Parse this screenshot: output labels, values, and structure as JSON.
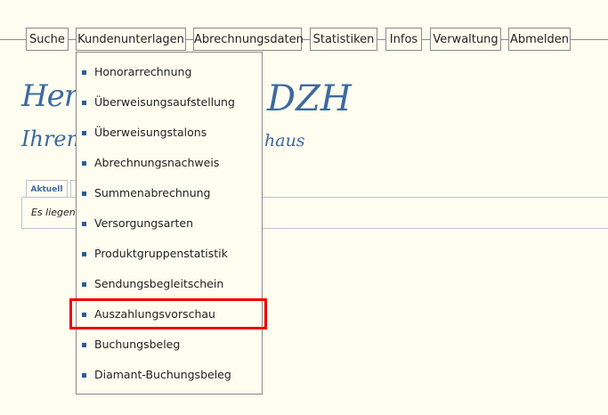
{
  "nav": {
    "items": [
      {
        "label": "Suche"
      },
      {
        "label": "Kundenunterlagen"
      },
      {
        "label": "Abrechnungsdaten"
      },
      {
        "label": "Statistiken"
      },
      {
        "label": "Infos"
      },
      {
        "label": "Verwaltung"
      },
      {
        "label": "Abmelden"
      }
    ]
  },
  "greeting": {
    "line1": "Herzli",
    "line1_end": "DZH",
    "line2": "Ihrem p",
    "line2_end": "haus"
  },
  "tabs": {
    "active_label": "Aktuell"
  },
  "panel": {
    "text": "Es liegen"
  },
  "dropdown": {
    "items": [
      {
        "label": "Honorarrechnung"
      },
      {
        "label": "Überweisungsaufstellung"
      },
      {
        "label": "Überweisungstalons"
      },
      {
        "label": "Abrechnungsnachweis"
      },
      {
        "label": "Summenabrechnung"
      },
      {
        "label": "Versorgungsarten"
      },
      {
        "label": "Produktgruppenstatistik"
      },
      {
        "label": "Sendungsbegleitschein"
      },
      {
        "label": "Auszahlungsvorschau"
      },
      {
        "label": "Buchungsbeleg"
      },
      {
        "label": "Diamant-Buchungsbeleg"
      }
    ],
    "highlighted_item": "Auszahlungsvorschau"
  },
  "colors": {
    "background": "#fefdf0",
    "accent": "#2b5d97",
    "greeting": "#3c6aa0",
    "highlight": "#f00000"
  }
}
